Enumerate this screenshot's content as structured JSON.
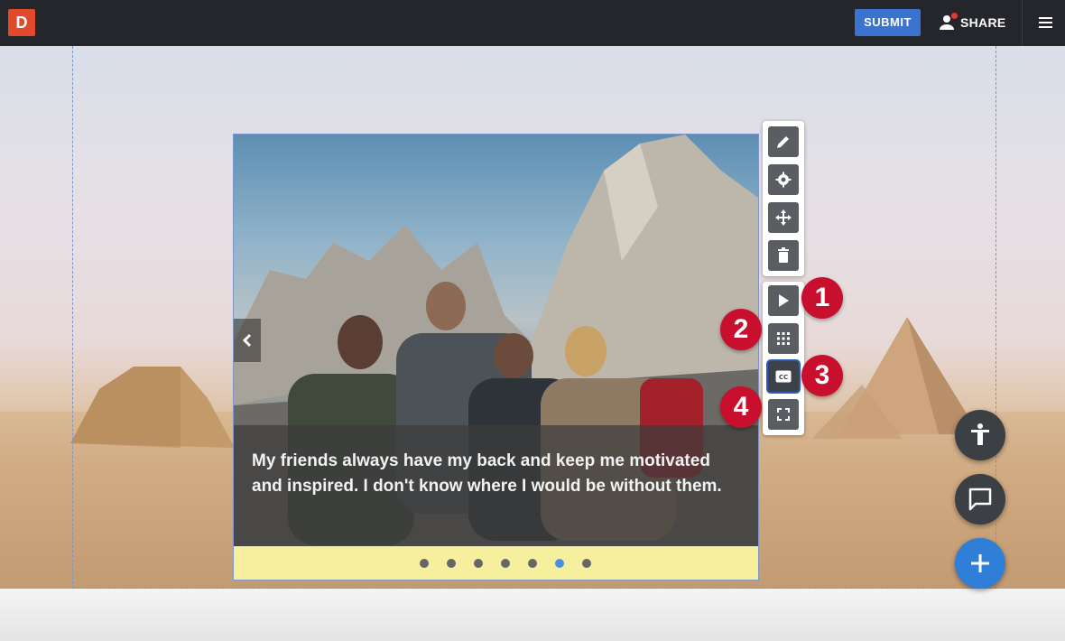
{
  "topbar": {
    "logo_text": "D",
    "submit_label": "SUBMIT",
    "share_label": "SHARE"
  },
  "slider": {
    "caption": "My friends always have my back and keep me motivated and inspired. I don't know where I would be without them.",
    "slide_count": 7,
    "active_slide": 6
  },
  "toolbar_top": [
    "edit",
    "settings",
    "move",
    "delete"
  ],
  "toolbar_bottom": [
    "play",
    "grid",
    "closed-captions",
    "fullscreen"
  ],
  "badges": [
    "1",
    "2",
    "3",
    "4"
  ],
  "colors": {
    "topbar": "#24262b",
    "submit": "#3b73d1",
    "logo": "#e0492c",
    "badge": "#c8102e",
    "active_dot": "#4a8fe0",
    "fab_blue": "#2f7fd8"
  }
}
